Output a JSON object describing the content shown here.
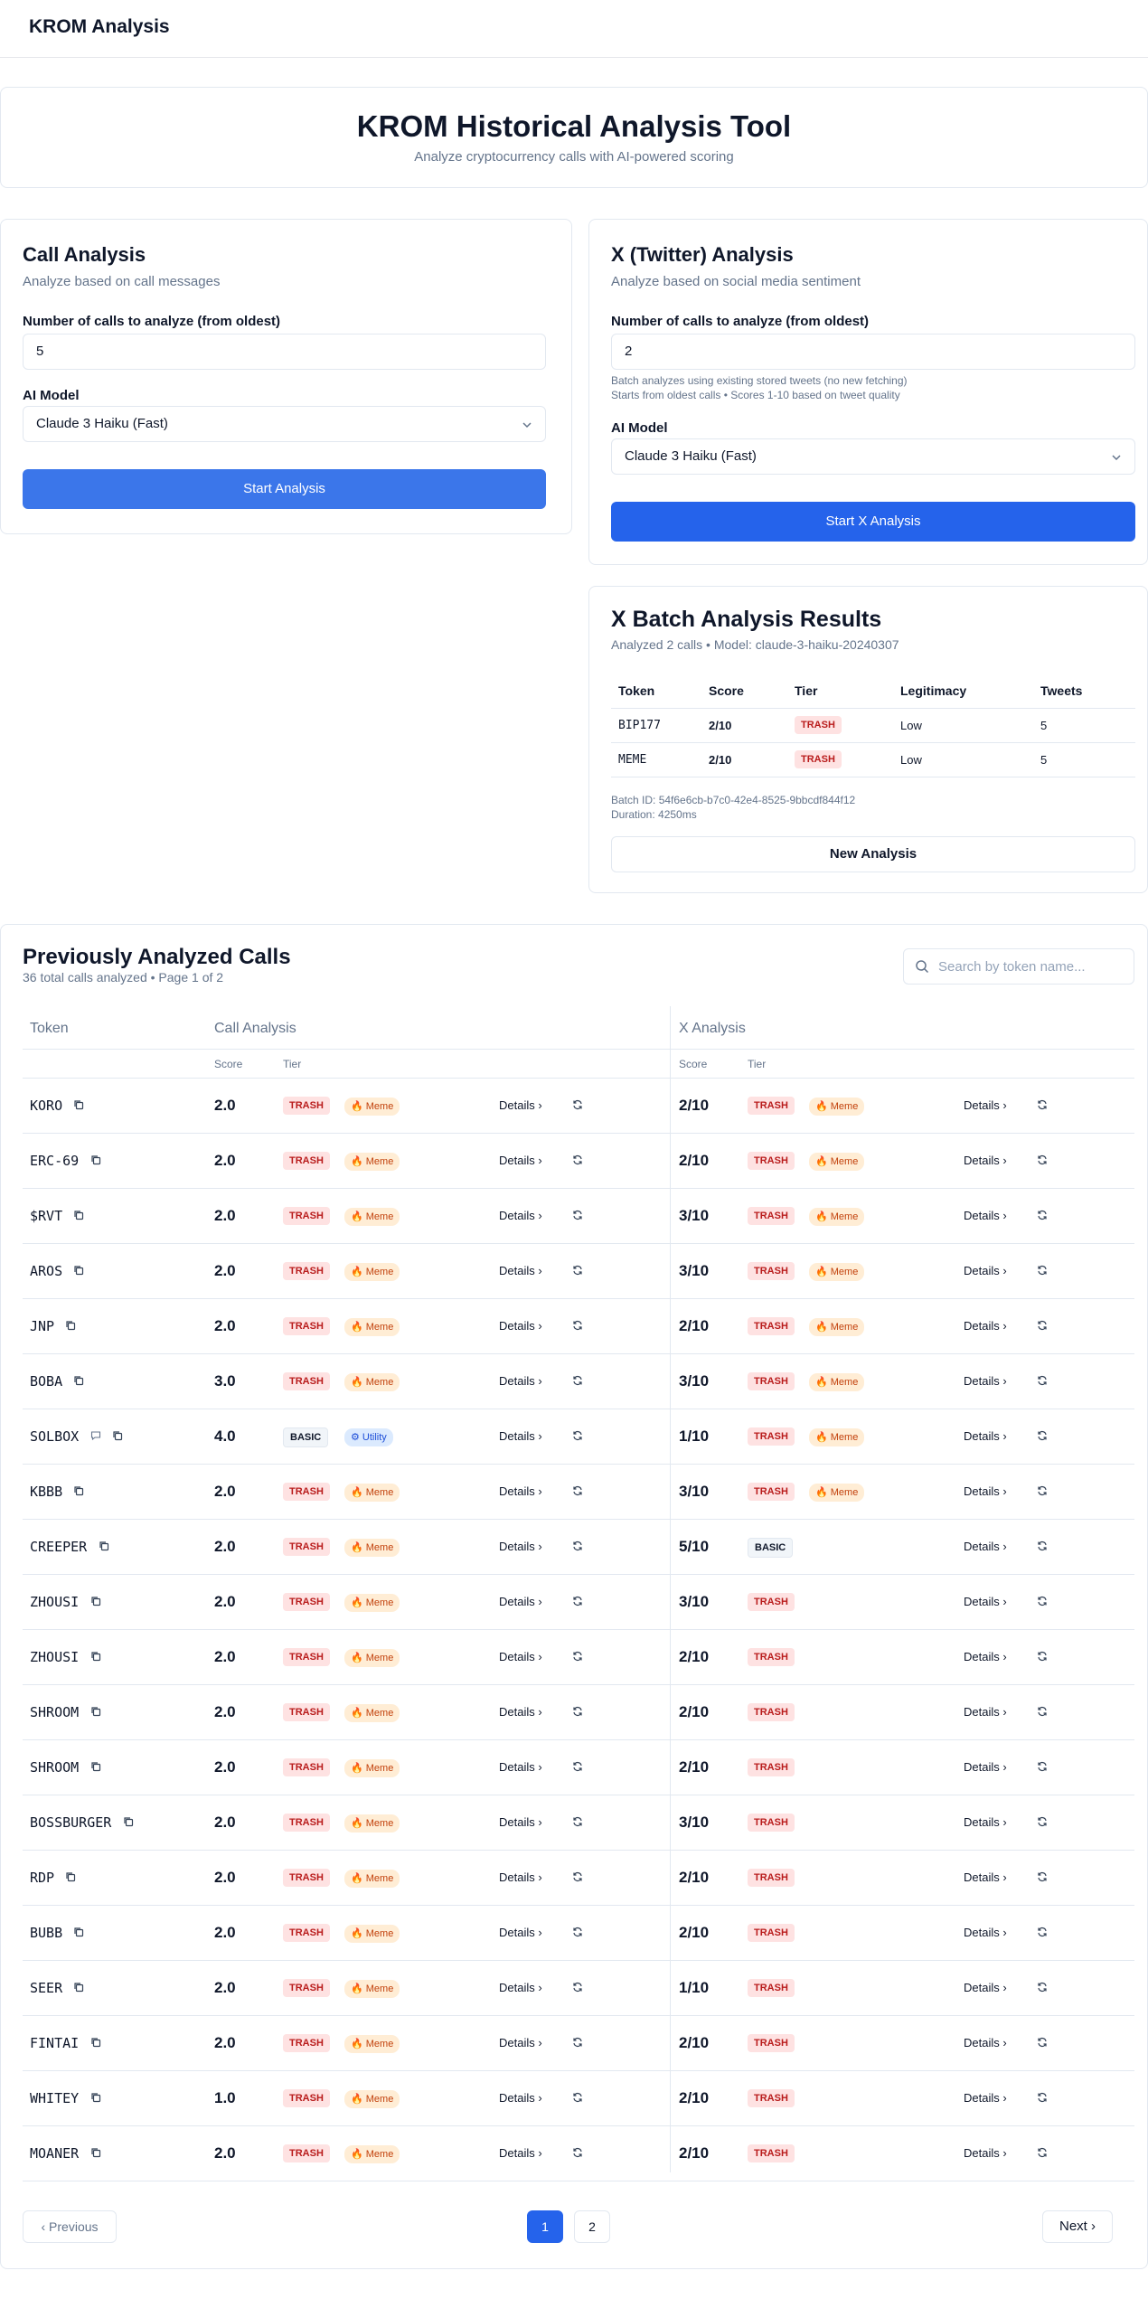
{
  "app": {
    "brand": "KROM Analysis"
  },
  "hero": {
    "title": "KROM Historical Analysis Tool",
    "subtitle": "Analyze cryptocurrency calls with AI-powered scoring"
  },
  "call_analysis": {
    "title": "Call Analysis",
    "subtitle": "Analyze based on call messages",
    "count_label": "Number of calls to analyze (from oldest)",
    "count_value": "5",
    "model_label": "AI Model",
    "model_value": "Claude 3 Haiku (Fast)",
    "button": "Start Analysis",
    "button_color": "#3b76ea"
  },
  "x_analysis": {
    "title": "X (Twitter) Analysis",
    "subtitle": "Analyze based on social media sentiment",
    "count_label": "Number of calls to analyze (from oldest)",
    "count_value": "2",
    "hint1": "Batch analyzes using existing stored tweets (no new fetching)",
    "hint2": "Starts from oldest calls • Scores 1-10 based on tweet quality",
    "model_label": "AI Model",
    "model_value": "Claude 3 Haiku (Fast)",
    "button": "Start X Analysis",
    "button_color": "#2563eb"
  },
  "batch_results": {
    "title": "X Batch Analysis Results",
    "subtitle": "Analyzed 2 calls • Model: claude-3-haiku-20240307",
    "headers": [
      "Token",
      "Score",
      "Tier",
      "Legitimacy",
      "Tweets"
    ],
    "rows": [
      {
        "token": "BIP177",
        "score": "2/10",
        "tier": "TRASH",
        "legitimacy": "Low",
        "tweets": "5"
      },
      {
        "token": "MEME",
        "score": "2/10",
        "tier": "TRASH",
        "legitimacy": "Low",
        "tweets": "5"
      }
    ],
    "batch_id": "Batch ID: 54f6e6cb-b7c0-42e4-8525-9bbcdf844f12",
    "duration": "Duration: 4250ms",
    "new_button": "New Analysis"
  },
  "previous": {
    "title": "Previously Analyzed Calls",
    "subtitle": "36 total calls analyzed • Page 1 of 2",
    "search_placeholder": "Search by token name...",
    "col_token": "Token",
    "col_call": "Call Analysis",
    "col_x": "X Analysis",
    "sub_score": "Score",
    "sub_tier": "Tier",
    "details_label": "Details",
    "rows": [
      {
        "token": "KORO",
        "cscore": "2.0",
        "ctier": "TRASH",
        "cmeta": "🔥 Meme",
        "xscore": "2/10",
        "xtier": "TRASH",
        "xmeta": "🔥 Meme"
      },
      {
        "token": "ERC-69",
        "cscore": "2.0",
        "ctier": "TRASH",
        "cmeta": "🔥 Meme",
        "xscore": "2/10",
        "xtier": "TRASH",
        "xmeta": "🔥 Meme"
      },
      {
        "token": "$RVT",
        "cscore": "2.0",
        "ctier": "TRASH",
        "cmeta": "🔥 Meme",
        "xscore": "3/10",
        "xtier": "TRASH",
        "xmeta": "🔥 Meme"
      },
      {
        "token": "AROS",
        "cscore": "2.0",
        "ctier": "TRASH",
        "cmeta": "🔥 Meme",
        "xscore": "3/10",
        "xtier": "TRASH",
        "xmeta": "🔥 Meme"
      },
      {
        "token": "JNP",
        "cscore": "2.0",
        "ctier": "TRASH",
        "cmeta": "🔥 Meme",
        "xscore": "2/10",
        "xtier": "TRASH",
        "xmeta": "🔥 Meme"
      },
      {
        "token": "BOBA",
        "cscore": "3.0",
        "ctier": "TRASH",
        "cmeta": "🔥 Meme",
        "xscore": "3/10",
        "xtier": "TRASH",
        "xmeta": "🔥 Meme"
      },
      {
        "token": "SOLBOX",
        "cscore": "4.0",
        "ctier": "BASIC",
        "cmeta": "⚙ Utility",
        "xscore": "1/10",
        "xtier": "TRASH",
        "xmeta": "🔥 Meme",
        "comment": true
      },
      {
        "token": "KBBB",
        "cscore": "2.0",
        "ctier": "TRASH",
        "cmeta": "🔥 Meme",
        "xscore": "3/10",
        "xtier": "TRASH",
        "xmeta": "🔥 Meme"
      },
      {
        "token": "CREEPER",
        "cscore": "2.0",
        "ctier": "TRASH",
        "cmeta": "🔥 Meme",
        "xscore": "5/10",
        "xtier": "BASIC",
        "xmeta": ""
      },
      {
        "token": "ZHOUSI",
        "cscore": "2.0",
        "ctier": "TRASH",
        "cmeta": "🔥 Meme",
        "xscore": "3/10",
        "xtier": "TRASH",
        "xmeta": ""
      },
      {
        "token": "ZHOUSI",
        "cscore": "2.0",
        "ctier": "TRASH",
        "cmeta": "🔥 Meme",
        "xscore": "2/10",
        "xtier": "TRASH",
        "xmeta": ""
      },
      {
        "token": "SHROOM",
        "cscore": "2.0",
        "ctier": "TRASH",
        "cmeta": "🔥 Meme",
        "xscore": "2/10",
        "xtier": "TRASH",
        "xmeta": ""
      },
      {
        "token": "SHROOM",
        "cscore": "2.0",
        "ctier": "TRASH",
        "cmeta": "🔥 Meme",
        "xscore": "2/10",
        "xtier": "TRASH",
        "xmeta": ""
      },
      {
        "token": "BOSSBURGER",
        "cscore": "2.0",
        "ctier": "TRASH",
        "cmeta": "🔥 Meme",
        "xscore": "3/10",
        "xtier": "TRASH",
        "xmeta": ""
      },
      {
        "token": "RDP",
        "cscore": "2.0",
        "ctier": "TRASH",
        "cmeta": "🔥 Meme",
        "xscore": "2/10",
        "xtier": "TRASH",
        "xmeta": ""
      },
      {
        "token": "BUBB",
        "cscore": "2.0",
        "ctier": "TRASH",
        "cmeta": "🔥 Meme",
        "xscore": "2/10",
        "xtier": "TRASH",
        "xmeta": ""
      },
      {
        "token": "SEER",
        "cscore": "2.0",
        "ctier": "TRASH",
        "cmeta": "🔥 Meme",
        "xscore": "1/10",
        "xtier": "TRASH",
        "xmeta": ""
      },
      {
        "token": "FINTAI",
        "cscore": "2.0",
        "ctier": "TRASH",
        "cmeta": "🔥 Meme",
        "xscore": "2/10",
        "xtier": "TRASH",
        "xmeta": ""
      },
      {
        "token": "WHITEY",
        "cscore": "1.0",
        "ctier": "TRASH",
        "cmeta": "🔥 Meme",
        "xscore": "2/10",
        "xtier": "TRASH",
        "xmeta": ""
      },
      {
        "token": "MOANER",
        "cscore": "2.0",
        "ctier": "TRASH",
        "cmeta": "🔥 Meme",
        "xscore": "2/10",
        "xtier": "TRASH",
        "xmeta": ""
      }
    ],
    "pager": {
      "prev": "Previous",
      "page1": "1",
      "page2": "2",
      "next": "Next"
    }
  }
}
